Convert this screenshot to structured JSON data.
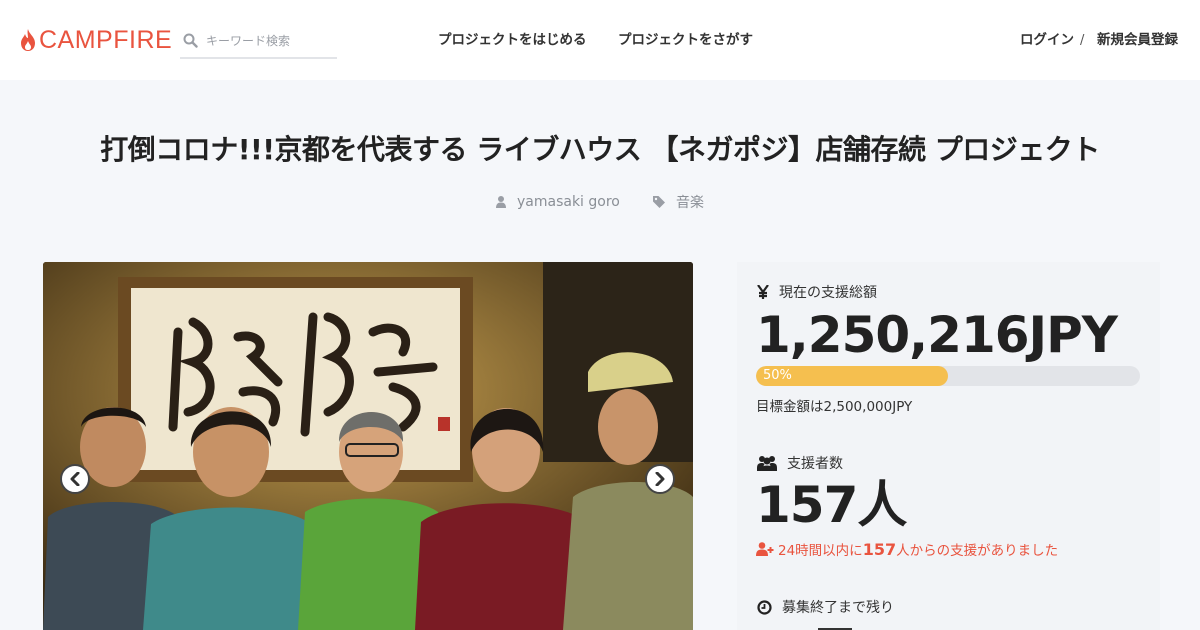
{
  "header": {
    "logo_text": "CAMPFIRE",
    "search_placeholder": "キーワード検索",
    "nav_start": "プロジェクトをはじめる",
    "nav_find": "プロジェクトをさがす",
    "login": "ログイン",
    "separator": "/",
    "signup": "新規会員登録"
  },
  "project": {
    "title": "打倒コロナ!!!京都を代表する ライブハウス 【ネガポジ】店舗存続 プロジェクト",
    "owner": "yamasaki goro",
    "category": "音楽"
  },
  "stats": {
    "amount_label": "現在の支援総額",
    "amount": "1,250,216JPY",
    "progress_percent": 50,
    "progress_label": "50%",
    "goal_text": "目標金額は2,500,000JPY",
    "backers_label": "支援者数",
    "backers": "157人",
    "recent_prefix": "24時間以内に",
    "recent_count": "157",
    "recent_suffix": "人からの支援がありました",
    "remaining_label": "募集終了まで残り"
  },
  "colors": {
    "brand": "#e9543f",
    "progress_fill": "#f5bf4f",
    "progress_track": "#e2e4e8",
    "panel_bg": "#f2f4f7",
    "page_bg": "#f5f7fa"
  },
  "icons": {
    "logo": "flame-icon",
    "search": "search-icon",
    "owner": "user-icon",
    "category": "tag-icon",
    "amount": "yen-icon",
    "backers": "users-icon",
    "recent": "user-plus-icon",
    "remaining": "clock-icon",
    "prev": "chevron-left-icon",
    "next": "chevron-right-icon"
  }
}
